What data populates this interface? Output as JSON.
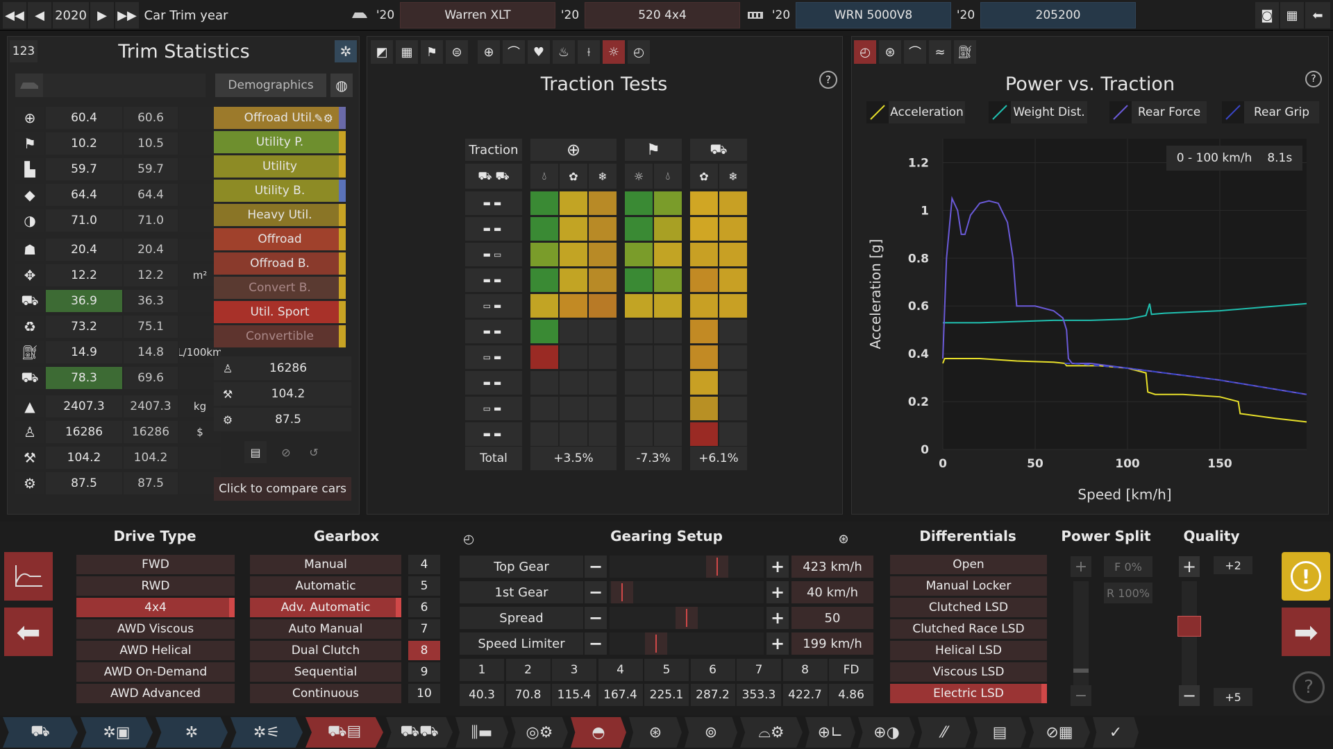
{
  "topbar": {
    "year": "2020",
    "year_label": "Car Trim year",
    "model_year": "'20",
    "model": "Warren XLT",
    "trim_year": "'20",
    "trim": "520 4x4",
    "engine_year": "'20",
    "engine": "WRN 5000V8",
    "variant_year": "'20",
    "variant": "205200"
  },
  "trim_stats": {
    "count": "123",
    "title": "Trim Statistics",
    "demographics_label": "Demographics",
    "rows": [
      {
        "icon": "steering-wheel-icon",
        "v1": "60.4",
        "v2": "60.6",
        "unit": "",
        "hl": false
      },
      {
        "icon": "race-flag-icon",
        "v1": "10.2",
        "v2": "10.5",
        "unit": "",
        "hl": false
      },
      {
        "icon": "seat-icon",
        "v1": "59.7",
        "v2": "59.7",
        "unit": "",
        "hl": false
      },
      {
        "icon": "shield-icon",
        "v1": "64.4",
        "v2": "64.4",
        "unit": "",
        "hl": false
      },
      {
        "icon": "ball-icon",
        "v1": "71.0",
        "v2": "71.0",
        "unit": "",
        "hl": false
      },
      {
        "icon": "passengers-icon",
        "v1": "20.4",
        "v2": "20.4",
        "unit": "",
        "hl": false
      },
      {
        "icon": "area-arrows-icon",
        "v1": "12.2",
        "v2": "12.2",
        "unit": "m²",
        "hl": false
      },
      {
        "icon": "offroad-car-icon",
        "v1": "36.9",
        "v2": "36.3",
        "unit": "",
        "hl": true
      },
      {
        "icon": "eco-icon",
        "v1": "73.2",
        "v2": "75.1",
        "unit": "",
        "hl": false
      },
      {
        "icon": "fuel-icon",
        "v1": "14.9",
        "v2": "14.8",
        "unit": "L/100km",
        "hl": false
      },
      {
        "icon": "towing-icon",
        "v1": "78.3",
        "v2": "69.6",
        "unit": "",
        "hl": true
      },
      {
        "icon": "weight-icon",
        "v1": "2407.3",
        "v2": "2407.3",
        "unit": "kg",
        "hl": false
      },
      {
        "icon": "price-icon",
        "v1": "16286",
        "v2": "16286",
        "unit": "$",
        "hl": false
      },
      {
        "icon": "service-icon",
        "v1": "104.2",
        "v2": "104.2",
        "unit": "",
        "hl": false
      },
      {
        "icon": "reliability-icon",
        "v1": "87.5",
        "v2": "87.5",
        "unit": "",
        "hl": false
      }
    ],
    "demographics": [
      {
        "label": "Offroad Util.",
        "bg": "#9c7a2b",
        "bar": "#6a6aa8"
      },
      {
        "label": "Utility P.",
        "bg": "#6e8f2e",
        "bar": "#c8a324"
      },
      {
        "label": "Utility",
        "bg": "#8d8b25",
        "bar": "#c8a324"
      },
      {
        "label": "Utility B.",
        "bg": "#8d8b25",
        "bar": "#5a72b8"
      },
      {
        "label": "Heavy Util.",
        "bg": "#8a7526",
        "bar": "#c8a324"
      },
      {
        "label": "Offroad",
        "bg": "#a0412c",
        "bar": "#c8a324"
      },
      {
        "label": "Offroad B.",
        "bg": "#8a3a2c",
        "bar": "#c8a324"
      },
      {
        "label": "Convert B.",
        "bg": "#5a3a31",
        "bar": "#c8a324"
      },
      {
        "label": "Util. Sport",
        "bg": "#a83129",
        "bar": "#c8a324"
      },
      {
        "label": "Convertible",
        "bg": "#5e342e",
        "bar": "#c8a324"
      }
    ],
    "summary": [
      {
        "icon": "price-icon",
        "value": "16286"
      },
      {
        "icon": "service-icon",
        "value": "104.2"
      },
      {
        "icon": "reliability-icon",
        "value": "87.5"
      }
    ],
    "compare_label": "Click to compare cars"
  },
  "traction": {
    "title": "Traction Tests",
    "header_label": "Traction",
    "total_label": "Total",
    "totals": [
      "+3.5%",
      "-7.3%",
      "+6.1%"
    ],
    "grid": [
      [
        "#3a8a34",
        "#c2a424",
        "#b88a26",
        "#3a8a34",
        "#7a9c2a",
        "#d0a624",
        "#c8a024"
      ],
      [
        "#3a8a34",
        "#c2a424",
        "#b88a26",
        "#3a8a34",
        "#a8a024",
        "#d0a624",
        "#c8a024"
      ],
      [
        "#7a9c2a",
        "#c2a424",
        "#b88a26",
        "#7a9c2a",
        "#c2a424",
        "#c8a024",
        "#c8a024"
      ],
      [
        "#3a8a34",
        "#c2a424",
        "#b88a26",
        "#3a8a34",
        "#7a9c2a",
        "#c28a24",
        "#c8a024"
      ],
      [
        "#c2a424",
        "#c28a24",
        "#b87a26",
        "#c2a424",
        "#c2a424",
        "#c8a024",
        "#c8a024"
      ],
      [
        "#3a8a34",
        "#2e2e2e",
        "#2e2e2e",
        "#2e2e2e",
        "#2e2e2e",
        "#c28a24",
        "#2e2e2e"
      ],
      [
        "#9a2a24",
        "#2e2e2e",
        "#2e2e2e",
        "#2e2e2e",
        "#2e2e2e",
        "#c28a24",
        "#2e2e2e"
      ],
      [
        "#2e2e2e",
        "#2e2e2e",
        "#2e2e2e",
        "#2e2e2e",
        "#2e2e2e",
        "#c8a024",
        "#2e2e2e"
      ],
      [
        "#2e2e2e",
        "#2e2e2e",
        "#2e2e2e",
        "#2e2e2e",
        "#2e2e2e",
        "#b89024",
        "#2e2e2e"
      ],
      [
        "#2e2e2e",
        "#2e2e2e",
        "#2e2e2e",
        "#2e2e2e",
        "#2e2e2e",
        "#9a2a24",
        "#2e2e2e"
      ]
    ]
  },
  "power_traction": {
    "title": "Power vs. Traction",
    "legend": [
      {
        "label": "Acceleration",
        "color": "#e8e02a"
      },
      {
        "label": "Weight Dist.",
        "color": "#20c0b0"
      },
      {
        "label": "Rear Force",
        "color": "#6a5ad8"
      },
      {
        "label": "Rear Grip",
        "color": "#3a46c8"
      }
    ],
    "zero_to_100_label": "0 - 100 km/h",
    "zero_to_100_value": "8.1s"
  },
  "chart_data": {
    "type": "line",
    "title": "Power vs. Traction",
    "xlabel": "Speed [km/h]",
    "ylabel": "Acceleration [g]",
    "xlim": [
      0,
      197
    ],
    "ylim": [
      0,
      1.3
    ],
    "xticks": [
      "0",
      "50",
      "100",
      "150"
    ],
    "yticks": [
      "0",
      "0.2",
      "0.4",
      "0.6",
      "0.8",
      "1",
      "1.2"
    ],
    "series": [
      {
        "name": "Acceleration",
        "color": "#e8e02a",
        "x": [
          0,
          1,
          10,
          20,
          40,
          60,
          66,
          67,
          70,
          85,
          100,
          110,
          111,
          115,
          130,
          150,
          160,
          161,
          180,
          197
        ],
        "y": [
          0.36,
          0.38,
          0.38,
          0.38,
          0.37,
          0.365,
          0.36,
          0.35,
          0.35,
          0.35,
          0.34,
          0.32,
          0.24,
          0.23,
          0.23,
          0.22,
          0.2,
          0.15,
          0.13,
          0.115
        ]
      },
      {
        "name": "Weight Dist.",
        "color": "#20c0b0",
        "x": [
          0,
          1,
          20,
          40,
          60,
          70,
          80,
          100,
          110,
          112,
          113,
          120,
          150,
          197
        ],
        "y": [
          0.53,
          0.53,
          0.53,
          0.535,
          0.54,
          0.54,
          0.54,
          0.545,
          0.56,
          0.61,
          0.565,
          0.57,
          0.58,
          0.61
        ]
      },
      {
        "name": "Rear Force",
        "color": "#6a5ad8",
        "x": [
          0,
          2,
          5,
          8,
          10,
          12,
          15,
          20,
          25,
          30,
          35,
          38,
          40,
          50,
          60,
          65,
          67,
          68,
          70,
          80,
          100,
          120,
          150,
          197
        ],
        "y": [
          0.38,
          0.8,
          1.05,
          1.0,
          0.9,
          0.9,
          0.98,
          1.03,
          1.04,
          1.03,
          0.95,
          0.8,
          0.6,
          0.6,
          0.58,
          0.55,
          0.5,
          0.38,
          0.36,
          0.36,
          0.34,
          0.32,
          0.29,
          0.23
        ]
      },
      {
        "name": "Rear Grip",
        "color": "#3a46c8",
        "x": [
          66,
          70,
          100,
          150,
          197
        ],
        "y": [
          0.36,
          0.36,
          0.34,
          0.29,
          0.23
        ]
      }
    ]
  },
  "drive_type": {
    "title": "Drive Type",
    "items": [
      "FWD",
      "RWD",
      "4x4",
      "AWD Viscous",
      "AWD Helical",
      "AWD On-Demand",
      "AWD Advanced"
    ],
    "selected": 2
  },
  "gearbox": {
    "title": "Gearbox",
    "items": [
      "Manual",
      "Automatic",
      "Adv. Automatic",
      "Auto Manual",
      "Dual Clutch",
      "Sequential",
      "Continuous"
    ],
    "selected": 2,
    "gears": [
      "4",
      "5",
      "6",
      "7",
      "8",
      "9",
      "10"
    ],
    "selected_gear": 4
  },
  "gearing": {
    "title": "Gearing Setup",
    "rows": [
      {
        "label": "Top Gear",
        "value": "423 km/h",
        "pos": 0.7
      },
      {
        "label": "1st Gear",
        "value": "40 km/h",
        "pos": 0.08
      },
      {
        "label": "Spread",
        "value": "50",
        "pos": 0.5
      },
      {
        "label": "Speed Limiter",
        "value": "199 km/h",
        "pos": 0.3
      }
    ],
    "gear_numbers": [
      "1",
      "2",
      "3",
      "4",
      "5",
      "6",
      "7",
      "8",
      "FD"
    ],
    "gear_values": [
      "40.3",
      "70.8",
      "115.4",
      "167.4",
      "225.1",
      "287.2",
      "353.3",
      "422.7",
      "4.86"
    ]
  },
  "differentials": {
    "title": "Differentials",
    "items": [
      "Open",
      "Manual Locker",
      "Clutched LSD",
      "Clutched Race LSD",
      "Helical LSD",
      "Viscous LSD",
      "Electric LSD"
    ],
    "selected": 6
  },
  "power_split": {
    "title": "Power Split",
    "front": "F 0%",
    "rear": "R 100%"
  },
  "quality": {
    "title": "Quality",
    "top": "+2",
    "bottom": "+5"
  },
  "bottom_nav": [
    "car-icon",
    "engine-tab-icon",
    "chassis-tab-icon",
    "body-tab-icon",
    "trim-tab-icon",
    "suspension-tab-icon",
    "drivetrain-tab-icon",
    "brakes-tab-icon",
    "gauge-tab-icon",
    "wheel-tab-icon",
    "tyre-tab-icon",
    "aero-tab-icon",
    "interior-tab-icon",
    "safety-tab-icon",
    "fixture-tab-icon",
    "test-tab-icon",
    "finish-flag-icon",
    "checkmark-icon"
  ]
}
